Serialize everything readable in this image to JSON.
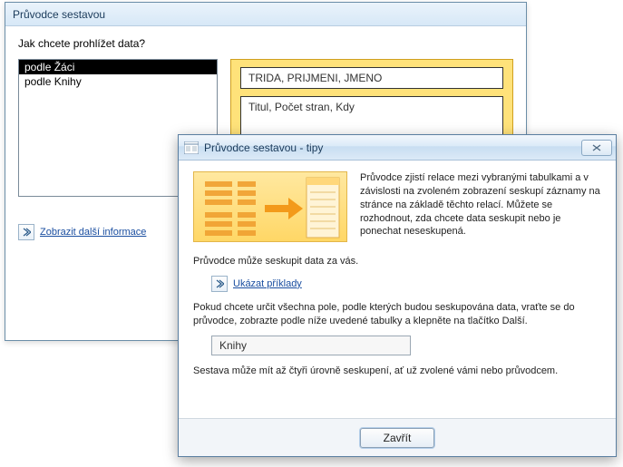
{
  "back": {
    "title": "Průvodce sestavou",
    "question": "Jak chcete prohlížet data?",
    "list": {
      "items": [
        {
          "label": "podle Žáci",
          "selected": true
        },
        {
          "label": "podle Knihy",
          "selected": false
        }
      ]
    },
    "preview": {
      "header": "TRIDA, PRIJMENI, JMENO",
      "body": "Titul, Počet stran, Kdy"
    },
    "more_link": "Zobrazit další informace"
  },
  "tips": {
    "title": "Průvodce sestavou - tipy",
    "top_text": "Průvodce zjistí relace mezi vybranými tabulkami a v závislosti na zvoleném zobrazení seskupí záznamy na stránce na základě těchto relací. Můžete se rozhodnout, zda chcete data seskupit nebo je ponechat neseskupená.",
    "line1": "Průvodce může seskupit data za vás.",
    "examples_label": "Ukázat příklady",
    "line2": "Pokud chcete určit všechna pole, podle kterých budou seskupována data, vraťte se do průvodce, zobrazte podle níže uvedené tabulky a klepněte na tlačítko Další.",
    "table_name": "Knihy",
    "line3": "Sestava může mít až čtyři úrovně seskupení, ať už zvolené vámi nebo průvodcem.",
    "close_button": "Zavřít"
  }
}
